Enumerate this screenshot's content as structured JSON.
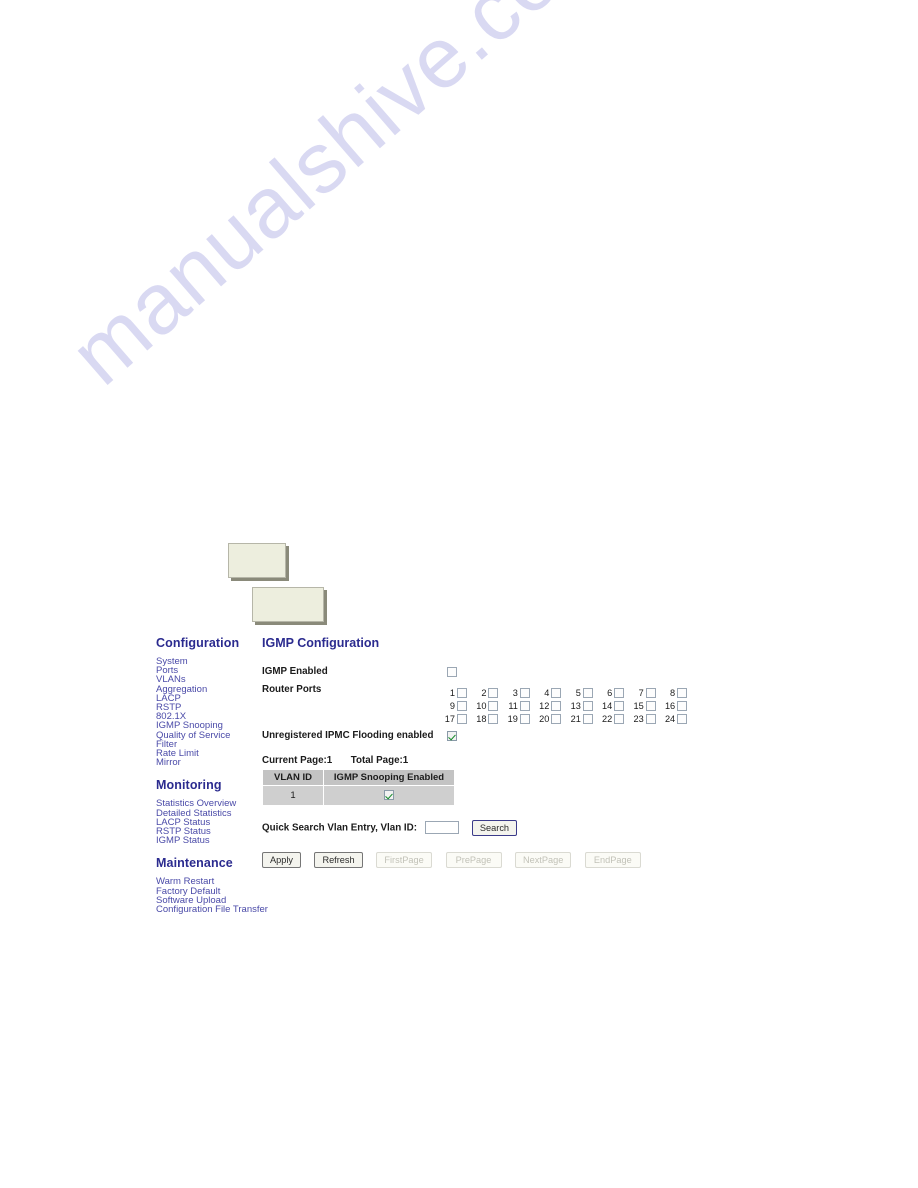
{
  "watermark": {
    "text": "manualshive.com"
  },
  "placeholders": [
    {
      "name": "top-image-placeholder"
    },
    {
      "name": "lower-image-placeholder"
    }
  ],
  "sidebar": {
    "sections": [
      {
        "heading": "Configuration",
        "items": [
          "System",
          "Ports",
          "VLANs",
          "Aggregation",
          "LACP",
          "RSTP",
          "802.1X",
          "IGMP Snooping",
          "Quality of Service",
          "Filter",
          "Rate Limit",
          "Mirror"
        ]
      },
      {
        "heading": "Monitoring",
        "items": [
          "Statistics Overview",
          "Detailed Statistics",
          "LACP Status",
          "RSTP Status",
          "IGMP Status"
        ]
      },
      {
        "heading": "Maintenance",
        "items": [
          "Warm Restart",
          "Factory Default",
          "Software Upload",
          "Configuration File Transfer"
        ]
      }
    ]
  },
  "content": {
    "title": "IGMP Configuration",
    "igmp_enabled": {
      "label": "IGMP Enabled",
      "checked": false
    },
    "router_ports": {
      "label": "Router Ports",
      "ports": [
        {
          "number": "1",
          "checked": false
        },
        {
          "number": "2",
          "checked": false
        },
        {
          "number": "3",
          "checked": false
        },
        {
          "number": "4",
          "checked": false
        },
        {
          "number": "5",
          "checked": false
        },
        {
          "number": "6",
          "checked": false
        },
        {
          "number": "7",
          "checked": false
        },
        {
          "number": "8",
          "checked": false
        },
        {
          "number": "9",
          "checked": false
        },
        {
          "number": "10",
          "checked": false
        },
        {
          "number": "11",
          "checked": false
        },
        {
          "number": "12",
          "checked": false
        },
        {
          "number": "13",
          "checked": false
        },
        {
          "number": "14",
          "checked": false
        },
        {
          "number": "15",
          "checked": false
        },
        {
          "number": "16",
          "checked": false
        },
        {
          "number": "17",
          "checked": false
        },
        {
          "number": "18",
          "checked": false
        },
        {
          "number": "19",
          "checked": false
        },
        {
          "number": "20",
          "checked": false
        },
        {
          "number": "21",
          "checked": false
        },
        {
          "number": "22",
          "checked": false
        },
        {
          "number": "23",
          "checked": false
        },
        {
          "number": "24",
          "checked": false
        }
      ]
    },
    "ipmc_flooding": {
      "label": "Unregistered IPMC Flooding enabled",
      "checked": true
    },
    "pagination_status": {
      "current_page": "Current Page:1",
      "total_page": "Total Page:1"
    },
    "vlan_table": {
      "columns": [
        "VLAN ID",
        "IGMP Snooping Enabled"
      ],
      "rows": [
        {
          "vlan_id": "1",
          "snooping_enabled": true
        }
      ]
    },
    "quick_search": {
      "label": "Quick Search Vlan Entry, Vlan ID:",
      "value": "",
      "placeholder": "",
      "button_label": "Search"
    },
    "buttons": [
      {
        "label": "Apply",
        "disabled": false
      },
      {
        "label": "Refresh",
        "disabled": false
      },
      {
        "label": "FirstPage",
        "disabled": true
      },
      {
        "label": "PrePage",
        "disabled": true
      },
      {
        "label": "NextPage",
        "disabled": true
      },
      {
        "label": "EndPage",
        "disabled": true
      }
    ]
  },
  "colors": {
    "heading": "#2b2b8f",
    "nav_link": "#4a4aa8",
    "table_header_bg": "#c3c3c3",
    "table_cell_bg": "#cfcfcf",
    "check_green": "#128a28",
    "placeholder_bg": "#edeede",
    "watermark": "#d9d9f2"
  }
}
